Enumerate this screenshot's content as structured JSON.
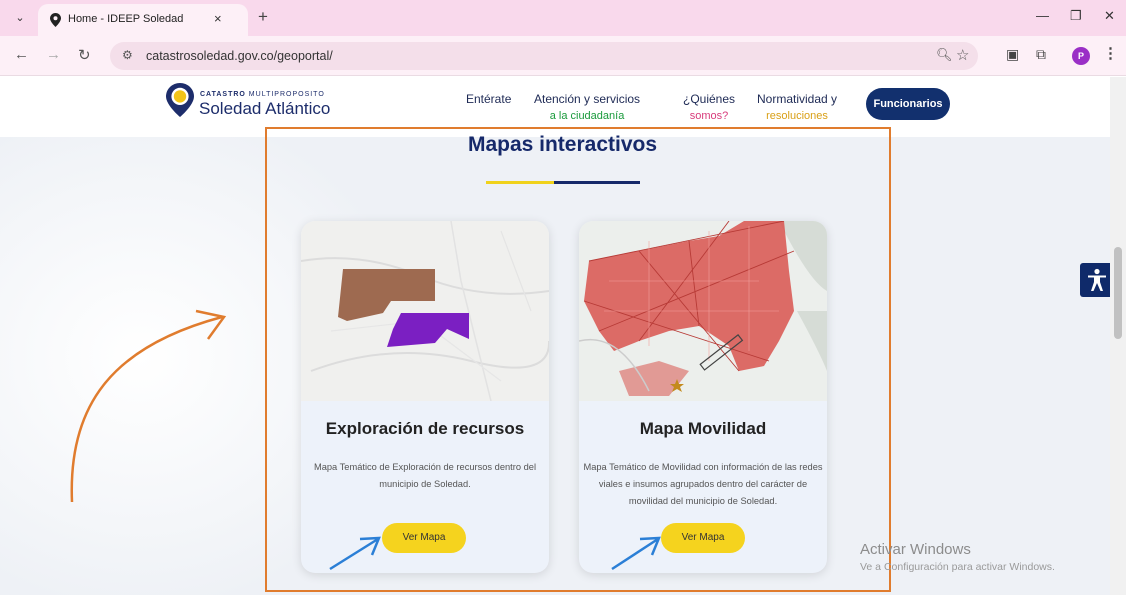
{
  "browser": {
    "tab_title": "Home - IDEEP Soledad",
    "tab_close": "×",
    "new_tab": "+",
    "url": "catastrosoledad.gov.co/geoportal/",
    "window": {
      "minimize": "—",
      "restore": "❐",
      "close": "✕"
    }
  },
  "header": {
    "logo": {
      "line1_bold": "CATASTRO",
      "line1_rest": " MULTIPROPOSITO",
      "line2": "Soledad Atlántico"
    },
    "nav": [
      {
        "line1": "Entérate",
        "line2": ""
      },
      {
        "line1": "Atención y servicios",
        "line2": "a la ciudadanía"
      },
      {
        "line1": "¿Quiénes",
        "line2": "somos?"
      },
      {
        "line1": "Normatividad y",
        "line2": "resoluciones"
      }
    ],
    "cta": "Funcionarios"
  },
  "section": {
    "title": "Mapas interactivos"
  },
  "cards": [
    {
      "title": "Exploración de recursos",
      "description": "Mapa Temático de Exploración de recursos dentro del municipio de Soledad.",
      "button": "Ver Mapa"
    },
    {
      "title": "Mapa Movilidad",
      "description": "Mapa Temático de Movilidad con información de las redes viales e insumos agrupados dentro del carácter de movilidad del municipio de Soledad.",
      "button": "Ver Mapa"
    }
  ],
  "windows_watermark": {
    "title": "Activar Windows",
    "subtitle": "Ve a Configuración para activar Windows."
  },
  "colors": {
    "navy": "#16296a",
    "yellow": "#f5d31e",
    "annotation_orange": "#e07c2e",
    "annotation_blue": "#2b7fd6"
  }
}
